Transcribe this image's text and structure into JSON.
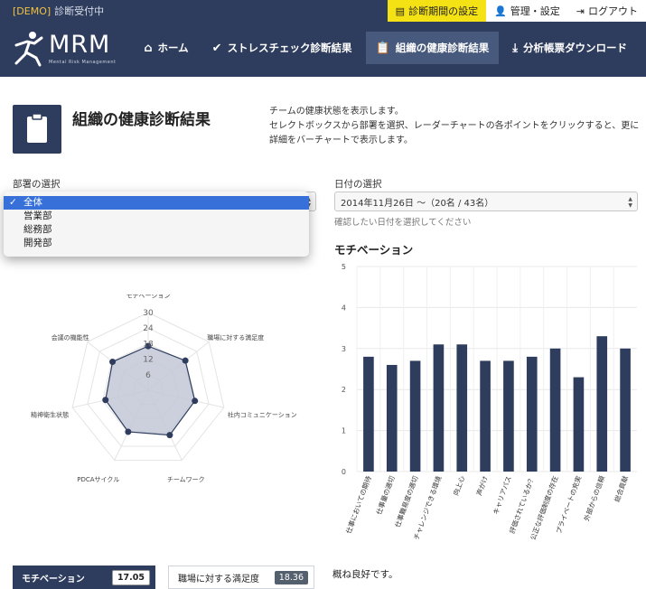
{
  "topbar": {
    "demo_tag": "[DEMO]",
    "status": "診断受付中",
    "period_button": "診断期間の設定",
    "admin_button": "管理・設定",
    "logout_button": "ログアウト"
  },
  "brand": {
    "logo_text": "MRM",
    "logo_sub": "Mental Risk Management"
  },
  "nav": {
    "items": [
      {
        "label": "ホーム",
        "icon": "home-icon"
      },
      {
        "label": "ストレスチェック診断結果",
        "icon": "check-icon"
      },
      {
        "label": "組織の健康診断結果",
        "icon": "clipboard-icon",
        "active": true
      },
      {
        "label": "分析帳票ダウンロード",
        "icon": "download-icon"
      }
    ]
  },
  "page": {
    "title": "組織の健康診断結果",
    "description_1": "チームの健康状態を表示します。",
    "description_2": "セレクトボックスから部署を選択、レーダーチャートの各ポイントをクリックすると、更に詳細をバーチャートで表示します。"
  },
  "department": {
    "label": "部署の選択",
    "selected": "全体",
    "options": [
      "全体",
      "営業部",
      "総務部",
      "開発部"
    ]
  },
  "date": {
    "label": "日付の選択",
    "selected": "2014年11月26日 〜（20名 / 43名）",
    "hint": "確認したい日付を選択してください"
  },
  "chart_data": [
    {
      "type": "radar",
      "categories": [
        "モチベーション",
        "職場に対する満足度",
        "社内コミュニケーション",
        "チームワーク",
        "PDCAサイクル",
        "精神衛生状態",
        "会議の機能性"
      ],
      "values": [
        17.05,
        18.36,
        18.5,
        19.2,
        17.8,
        16.9,
        17.6
      ],
      "rlim": [
        0,
        30
      ],
      "ticks": [
        6,
        12,
        18,
        24,
        30
      ],
      "tick_labels": [
        "6",
        "12",
        "18",
        "24",
        "30"
      ],
      "colors": {
        "fill": "#c3c8d6",
        "line": "#2e3d5e"
      }
    },
    {
      "type": "bar",
      "title": "モチベーション",
      "categories": [
        "仕事においての期待",
        "仕事量の適切",
        "仕事難易度の適切",
        "チャレンジできる環境",
        "向上心",
        "声がけ",
        "キャリアパス",
        "評価されているか？",
        "公正な評価制度の存在",
        "プライベートの充実",
        "外部からの信頼",
        "総合貢献"
      ],
      "values": [
        2.8,
        2.6,
        2.7,
        3.1,
        3.1,
        2.7,
        2.7,
        2.8,
        3.0,
        2.3,
        3.3,
        3.0
      ],
      "ylim": [
        0,
        5
      ],
      "yticks": [
        "0",
        "1",
        "2",
        "3",
        "4",
        "5"
      ],
      "color": "#2e3d5e",
      "grid": true
    }
  ],
  "scores": [
    {
      "label": "モチベーション",
      "value": "17.05"
    },
    {
      "label": "職場に対する満足度",
      "value": "18.36"
    }
  ],
  "summary": "概ね良好です。"
}
